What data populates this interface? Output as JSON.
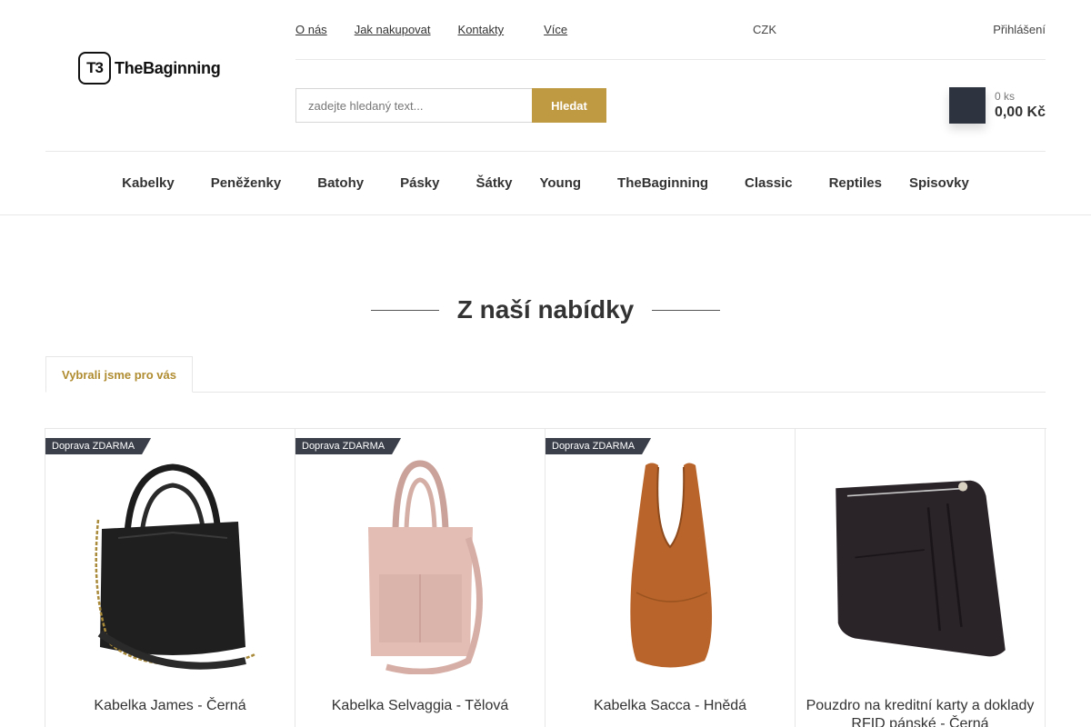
{
  "logo": {
    "mark": "T3",
    "text": "TheBaginning"
  },
  "topnav": {
    "about": "O nás",
    "how_to_buy": "Jak nakupovat",
    "contacts": "Kontakty",
    "more_icon": "",
    "more": "Více"
  },
  "currency": {
    "icon": "",
    "value": "CZK",
    "caret": ""
  },
  "login": {
    "icon": "",
    "label": "Přihlášení"
  },
  "search": {
    "placeholder": "zadejte hledaný text...",
    "button": "Hledat"
  },
  "cart": {
    "icon": "",
    "count": "0 ks",
    "price": "0,00 Kč"
  },
  "mainnav": {
    "items": [
      {
        "label": "Kabelky",
        "caret": ""
      },
      {
        "label": "Peněženky",
        "caret": ""
      },
      {
        "label": "Batohy",
        "caret": ""
      },
      {
        "label": "Pásky",
        "caret": ""
      },
      {
        "label": "Šátky"
      },
      {
        "label": "Young",
        "caret": ""
      },
      {
        "label": "TheBaginning",
        "caret": ""
      },
      {
        "label": "Classic",
        "caret": ""
      },
      {
        "label": "Reptiles"
      },
      {
        "label": "Spisovky"
      }
    ]
  },
  "section": {
    "title": "Z naší nabídky",
    "tab": "Vybrali jsme pro vás"
  },
  "products": [
    {
      "ribbon": "Doprava ZDARMA",
      "name": "Kabelka James - Černá",
      "image": "black-handbag"
    },
    {
      "ribbon": "Doprava ZDARMA",
      "name": "Kabelka Selvaggia - Tělová",
      "image": "pink-handbag"
    },
    {
      "ribbon": "Doprava ZDARMA",
      "name": "Kabelka Sacca - Hnědá",
      "image": "brown-hobo-bag"
    },
    {
      "name": "Pouzdro na kreditní karty a doklady RFID pánské - Černá",
      "image": "black-card-holder"
    }
  ],
  "colors": {
    "accent": "#c09a42",
    "dark": "#2e3340",
    "ribbon": "#3a3f4a"
  }
}
